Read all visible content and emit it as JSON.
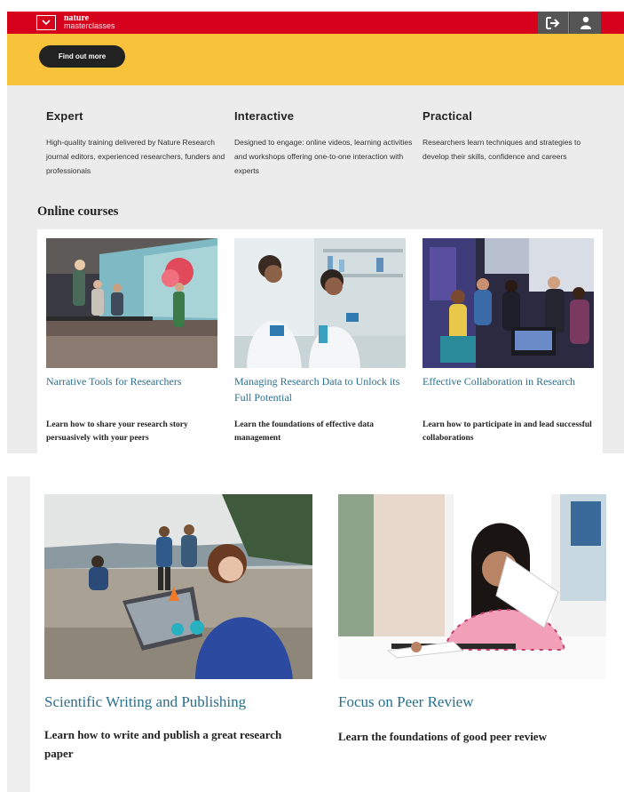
{
  "header": {
    "logo_line1": "nature",
    "logo_line2": "masterclasses",
    "menu_icon": "chevron-down-icon",
    "login_icon": "login-arrow-icon",
    "account_icon": "user-icon",
    "brand_color": "#d6001c"
  },
  "banner": {
    "button_label": "Find out more",
    "color": "#f8c33a"
  },
  "features": [
    {
      "title": "Expert",
      "text": "High-quality training delivered by Nature Research journal editors, experienced researchers, funders and professionals"
    },
    {
      "title": "Interactive",
      "text": "Designed to engage: online videos, learning activities and workshops offering one-to-one interaction with experts"
    },
    {
      "title": "Practical",
      "text": "Researchers learn techniques and strategies to develop their skills, confidence and careers"
    }
  ],
  "online_courses": {
    "heading": "Online courses",
    "items": [
      {
        "title": "Narrative Tools for Researchers",
        "description": "Learn how to share your research story persuasively with your peers"
      },
      {
        "title": "Managing Research Data to Unlock its Full Potential",
        "description": "Learn the foundations of effective data management"
      },
      {
        "title": "Effective Collaboration in Research",
        "description": "Learn how to participate in and lead successful collaborations"
      }
    ]
  },
  "more_courses": [
    {
      "title": "Scientific Writing and Publishing",
      "description": "Learn how to write and publish a great research paper"
    },
    {
      "title": "Focus on Peer Review",
      "description": "Learn the foundations of good peer review"
    }
  ],
  "colors": {
    "link": "#2a6f8f",
    "nav_dark": "#555555",
    "panel_bg": "#ececec"
  }
}
